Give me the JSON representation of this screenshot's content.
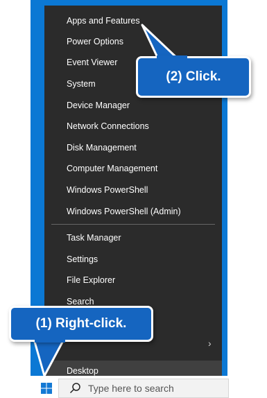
{
  "menu": {
    "items": [
      {
        "label": "Apps and Features"
      },
      {
        "label": "Power Options"
      },
      {
        "label": "Event Viewer"
      },
      {
        "label": "System"
      },
      {
        "label": "Device Manager"
      },
      {
        "label": "Network Connections"
      },
      {
        "label": "Disk Management"
      },
      {
        "label": "Computer Management"
      },
      {
        "label": "Windows PowerShell"
      },
      {
        "label": "Windows PowerShell (Admin)"
      },
      {
        "label": "Task Manager"
      },
      {
        "label": "Settings"
      },
      {
        "label": "File Explorer"
      },
      {
        "label": "Search"
      },
      {
        "label": "Desktop"
      }
    ]
  },
  "taskbar": {
    "search_placeholder": "Type here to search"
  },
  "callouts": {
    "step1": "(1) Right-click.",
    "step2": "(2) Click."
  },
  "colors": {
    "menu_bg": "#2b2b2b",
    "frame_blue": "#0b78d4",
    "callout_blue": "#1565c0"
  }
}
